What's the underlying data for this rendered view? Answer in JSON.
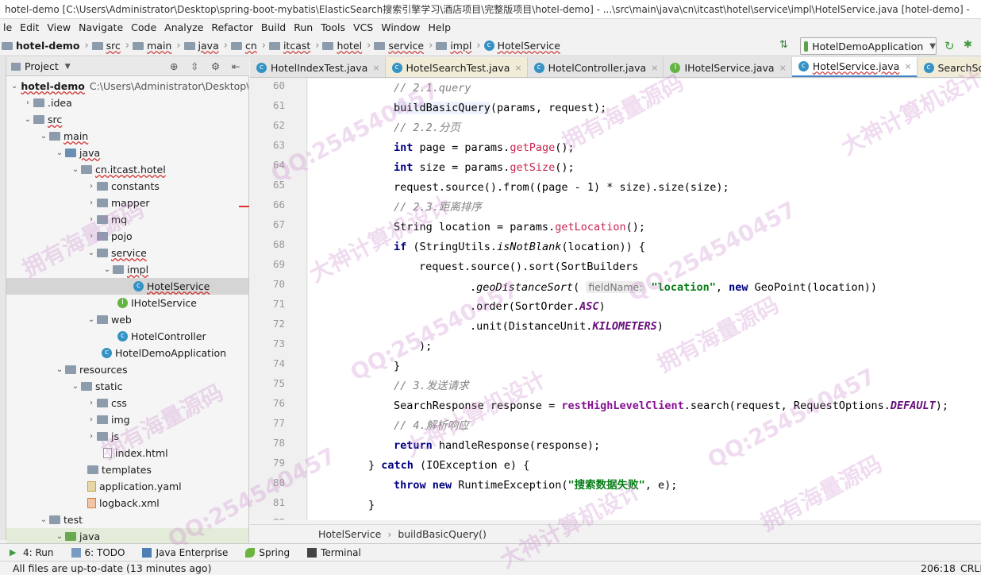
{
  "window": {
    "title": "hotel-demo [C:\\Users\\Administrator\\Desktop\\spring-boot-mybatis\\ElasticSearch搜索引擎学习\\酒店项目\\完整版项目\\hotel-demo] - ...\\src\\main\\java\\cn\\itcast\\hotel\\service\\impl\\HotelService.java [hotel-demo] -"
  },
  "menu": [
    "le",
    "Edit",
    "View",
    "Navigate",
    "Code",
    "Analyze",
    "Refactor",
    "Build",
    "Run",
    "Tools",
    "VCS",
    "Window",
    "Help"
  ],
  "nav": {
    "crumbs": [
      "hotel-demo",
      "src",
      "main",
      "java",
      "cn",
      "itcast",
      "hotel",
      "service",
      "impl",
      "HotelService"
    ],
    "run_config": "HotelDemoApplication"
  },
  "project_panel": {
    "title": "Project",
    "root_name": "hotel-demo",
    "root_path": "C:\\Users\\Administrator\\Desktop\\",
    "nodes": [
      {
        "label": ".idea"
      },
      {
        "label": "src"
      },
      {
        "label": "main"
      },
      {
        "label": "java"
      },
      {
        "label": "cn.itcast.hotel"
      },
      {
        "label": "constants"
      },
      {
        "label": "mapper"
      },
      {
        "label": "mq"
      },
      {
        "label": "pojo"
      },
      {
        "label": "service"
      },
      {
        "label": "impl"
      },
      {
        "label": "HotelService"
      },
      {
        "label": "IHotelService"
      },
      {
        "label": "web"
      },
      {
        "label": "HotelController"
      },
      {
        "label": "HotelDemoApplication"
      },
      {
        "label": "resources"
      },
      {
        "label": "static"
      },
      {
        "label": "css"
      },
      {
        "label": "img"
      },
      {
        "label": "js"
      },
      {
        "label": "index.html"
      },
      {
        "label": "templates"
      },
      {
        "label": "application.yaml"
      },
      {
        "label": "logback.xml"
      },
      {
        "label": "test"
      },
      {
        "label": "java"
      }
    ]
  },
  "tabs": [
    "HotelIndexTest.java",
    "HotelSearchTest.java",
    "HotelController.java",
    "IHotelService.java",
    "HotelService.java",
    "SearchSourceBuilde"
  ],
  "gutter": {
    "line_numbers": [
      "60",
      "61",
      "62",
      "63",
      "64",
      "65",
      "66",
      "67",
      "68",
      "69",
      "70",
      "71",
      "72",
      "73",
      "74",
      "75",
      "76",
      "77",
      "78",
      "79",
      "80",
      "81",
      "82"
    ]
  },
  "code": {
    "c60": "// 2.1.query",
    "c61a": "buildBasicQuery",
    "c61b": "(params, request);",
    "c62": "// 2.2.分页",
    "c63a": "int",
    "c63b": " page = params.",
    "c63c": "getPage",
    "c63d": "();",
    "c64a": "int",
    "c64b": " size = params.",
    "c64c": "getSize",
    "c64d": "();",
    "c65": "request.source().from((page - 1) * size).size(size);",
    "c66": "// 2.3.距离排序",
    "c67a": "String location = params.",
    "c67b": "getLocation",
    "c67c": "();",
    "c68a": "if",
    "c68b": " (StringUtils.",
    "c68c": "isNotBlank",
    "c68d": "(location)) {",
    "c69": "request.source().sort(SortBuilders",
    "c70a": ".",
    "c70b": "geoDistanceSort",
    "c70c": "(",
    "c70hint": "fieldName:",
    "c70d": "\"location\"",
    "c70e": ", ",
    "c70f": "new",
    "c70g": " GeoPoint(location))",
    "c71a": ".order(SortOrder.",
    "c71b": "ASC",
    "c71c": ")",
    "c72a": ".unit(DistanceUnit.",
    "c72b": "KILOMETERS",
    "c72c": ")",
    "c73": ");",
    "c74": "}",
    "c75": "// 3.发送请求",
    "c76a": "SearchResponse response = ",
    "c76b": "restHighLevelClient",
    "c76c": ".search(request, RequestOptions.",
    "c76d": "DEFAULT",
    "c76e": ");",
    "c77": "// 4.解析响应",
    "c78a": "return",
    "c78b": " handleResponse(response);",
    "c79a": "} ",
    "c79b": "catch",
    "c79c": " (IOException e) {",
    "c80a": "throw",
    "c80b": " ",
    "c80c": "new",
    "c80d": " RuntimeException(",
    "c80e": "\"搜索数据失败\"",
    "c80f": ", e);",
    "c81": "}"
  },
  "breadcrumb_bottom": [
    "HotelService",
    "buildBasicQuery()"
  ],
  "tool_windows": [
    "4: Run",
    "6: TODO",
    "Java Enterprise",
    "Spring",
    "Terminal"
  ],
  "status": {
    "message": "All files are up-to-date (13 minutes ago)",
    "position": "206:18",
    "line_sep": "CRLF"
  },
  "watermarks": [
    "QQ:254540457",
    "大神计算机设计",
    "拥有海量源码"
  ],
  "colors": {
    "accent": "#4083c9",
    "keyword": "#000080",
    "string": "#067d17",
    "comment": "#808080",
    "field": "#871094"
  }
}
